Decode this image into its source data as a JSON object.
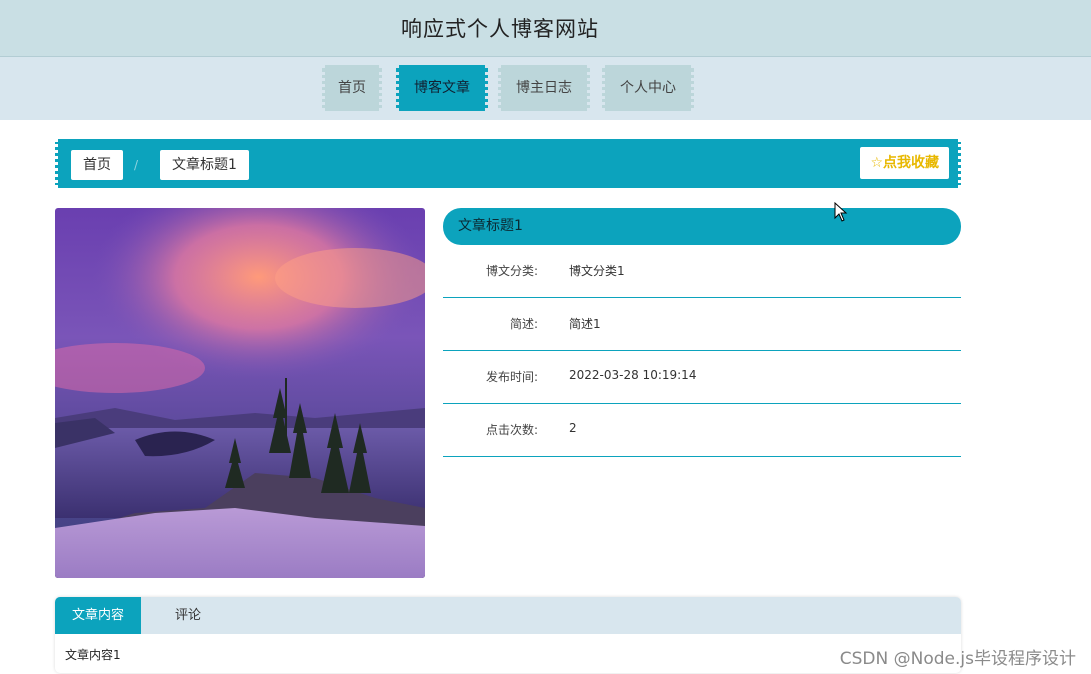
{
  "site": {
    "title": "响应式个人博客网站"
  },
  "nav": {
    "items": [
      {
        "label": "首页"
      },
      {
        "label": "博客文章"
      },
      {
        "label": "博主日志"
      },
      {
        "label": "个人中心"
      }
    ],
    "active_index": 1
  },
  "breadcrumb": {
    "home": "首页",
    "separator": "/",
    "current": "文章标题1"
  },
  "favorite": {
    "label": "点我收藏",
    "icon": "star-outline-icon"
  },
  "article": {
    "title": "文章标题1",
    "fields": [
      {
        "label": "博文分类:",
        "value": "博文分类1"
      },
      {
        "label": "简述:",
        "value": "简述1"
      },
      {
        "label": "发布时间:",
        "value": "2022-03-28 10:19:14"
      },
      {
        "label": "点击次数:",
        "value": "2"
      }
    ],
    "image": "lake-sunset-photo"
  },
  "tabs": {
    "items": [
      {
        "label": "文章内容"
      },
      {
        "label": "评论"
      }
    ],
    "active_index": 0
  },
  "content": {
    "text": "文章内容1"
  },
  "watermark": "CSDN @Node.js毕设程序设计",
  "colors": {
    "accent": "#0ca3bd",
    "header_bg": "#c9dfe4",
    "nav_bg": "#d8e6ee",
    "favorite": "#e8b800"
  }
}
